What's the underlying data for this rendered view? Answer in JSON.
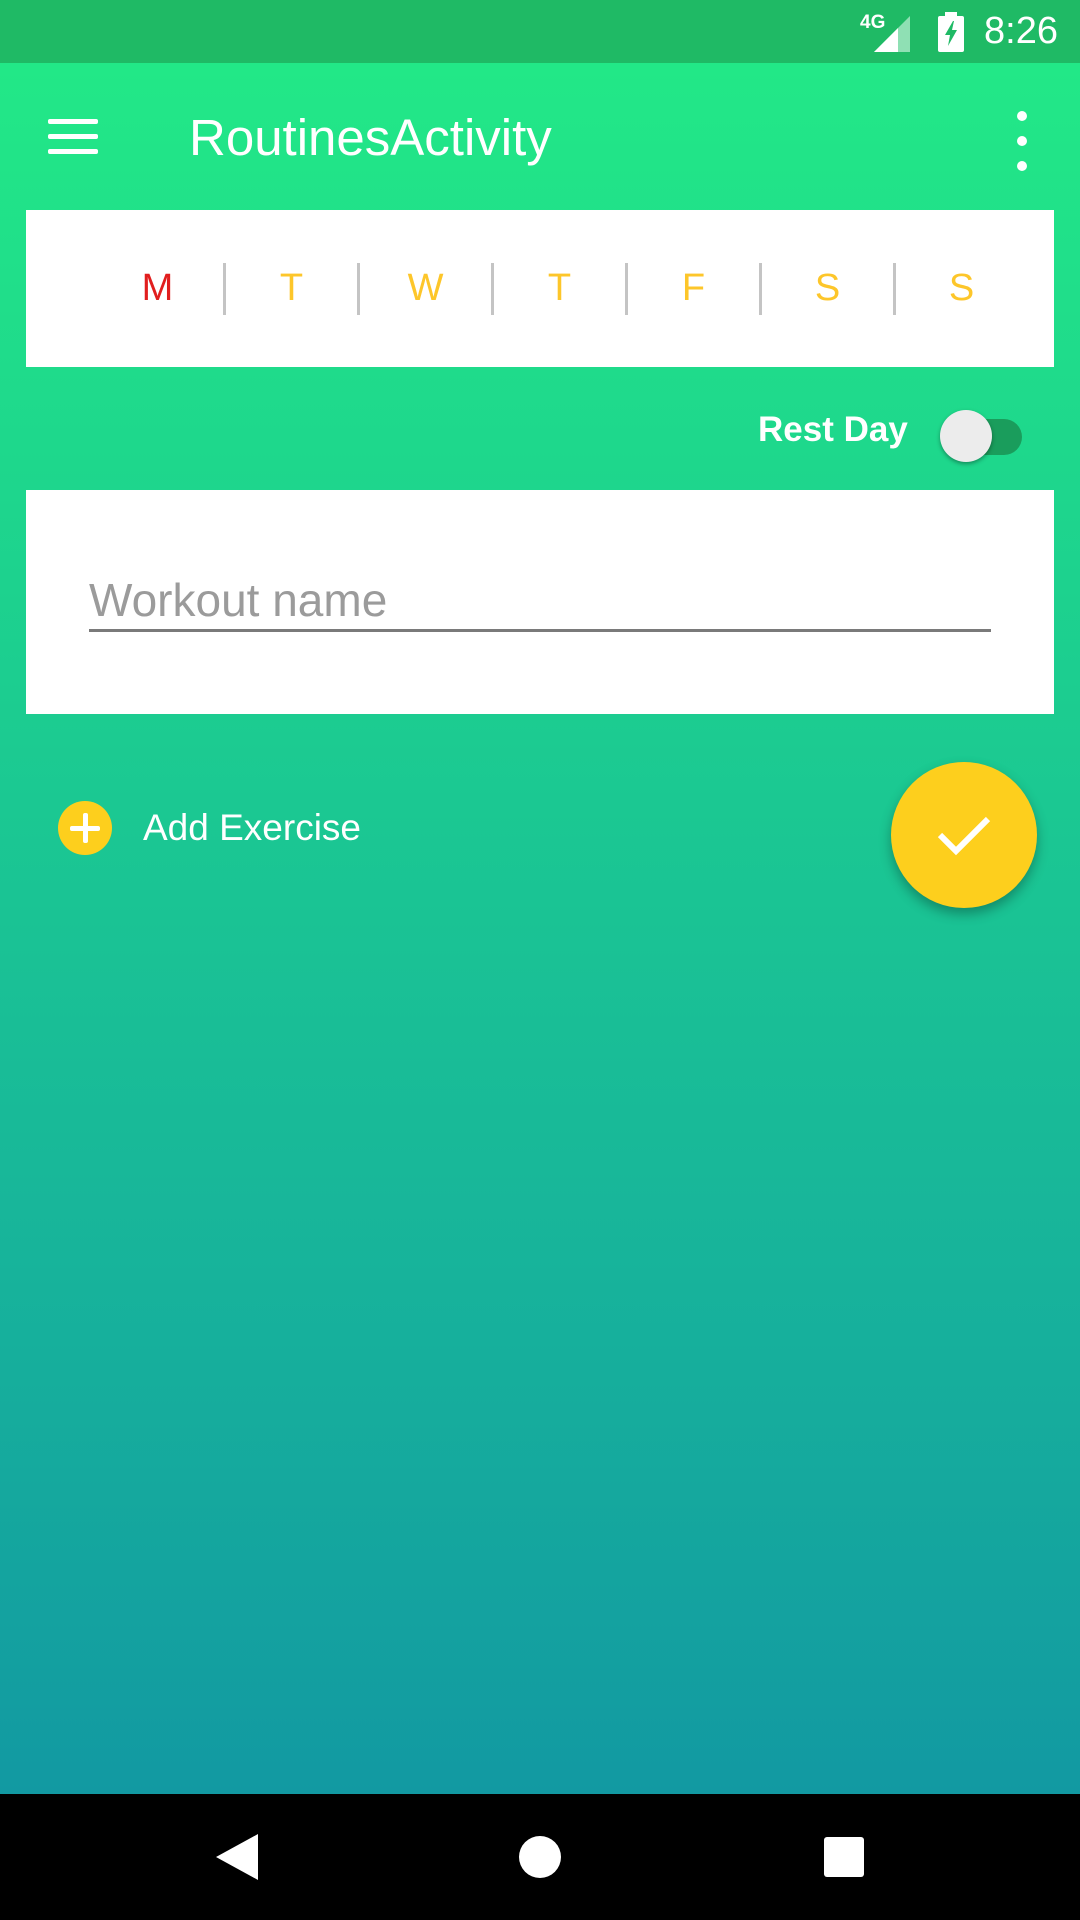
{
  "status_bar": {
    "network": "4G",
    "time": "8:26"
  },
  "app_bar": {
    "title": "RoutinesActivity"
  },
  "days": [
    {
      "label": "M",
      "active": true
    },
    {
      "label": "T",
      "active": false
    },
    {
      "label": "W",
      "active": false
    },
    {
      "label": "T",
      "active": false
    },
    {
      "label": "F",
      "active": false
    },
    {
      "label": "S",
      "active": false
    },
    {
      "label": "S",
      "active": false
    }
  ],
  "rest_day": {
    "label": "Rest Day",
    "enabled": false
  },
  "workout": {
    "value": "",
    "placeholder": "Workout name"
  },
  "add_exercise": {
    "label": "Add Exercise"
  },
  "colors": {
    "status_bar": "#1fba65",
    "gradient_top": "#22e887",
    "gradient_bottom": "#1299a2",
    "accent_yellow": "#fdcf1d",
    "active_day": "#e11e1e",
    "inactive_day": "#fdc62a"
  },
  "icons": {
    "menu": "menu-icon",
    "overflow": "more-vert-icon",
    "add": "add-circle-icon",
    "fab": "check-icon",
    "nav_back": "back-triangle-icon",
    "nav_home": "home-circle-icon",
    "nav_recent": "recents-square-icon"
  }
}
